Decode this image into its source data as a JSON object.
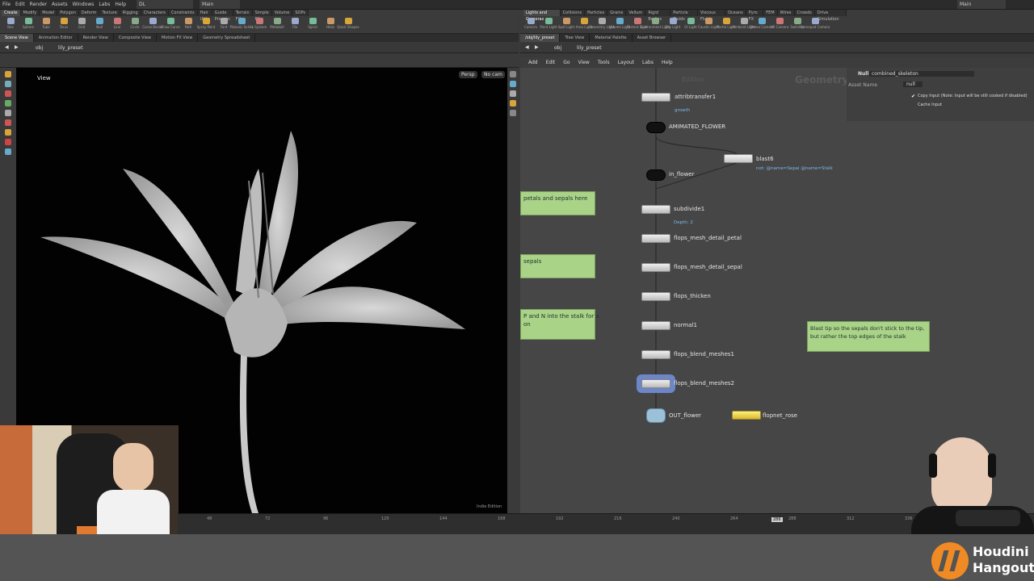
{
  "menubar": {
    "items": [
      "File",
      "Edit",
      "Render",
      "Assets",
      "Windows",
      "Labs",
      "Help"
    ],
    "desktop": "DL",
    "main_tab": "Main",
    "right_main": "Main"
  },
  "shelf_left": {
    "tabs": [
      "Create",
      "Modify",
      "Model",
      "Polygon",
      "Deform",
      "Texture",
      "Rigging",
      "Characters",
      "Constraints",
      "Hair Utils",
      "Guide Process",
      "Terrain FX",
      "Simple FX",
      "Volume",
      "SOPs"
    ],
    "tools": [
      "Box",
      "Sphere",
      "Tube",
      "Torus",
      "Grid",
      "Null",
      "Line",
      "Circle",
      "Curve Bezier",
      "Draw Curve",
      "Path",
      "Spray Paint",
      "Font",
      "Platonic Solids",
      "L-System",
      "Metaball",
      "File",
      "Spiral",
      "Helix",
      "Quick Shapes"
    ]
  },
  "shelf_right": {
    "tabs": [
      "Lights and Cameras",
      "Collisions",
      "Particles",
      "Grains",
      "Vellum",
      "Rigid Bodies",
      "Particle Fluids",
      "Viscous Fluids",
      "Oceans",
      "Pyro FX",
      "FEM",
      "Wires",
      "Crowds",
      "Drive Simulation"
    ],
    "tools": [
      "Camera",
      "Point Light",
      "Spot Light",
      "Area Light",
      "Geometry Light",
      "Volume Light",
      "Distant Light",
      "Environment Light",
      "Sky Light",
      "GI Light",
      "Caustic Light",
      "Portal Light",
      "Ambient Light",
      "Stereo Camera",
      "VR Camera",
      "Switcher",
      "Gamepad Camera"
    ]
  },
  "left_pane": {
    "tabs": [
      "Scene View",
      "Animation Editor",
      "Render View",
      "Composite View",
      "Motion FX View",
      "Geometry Spreadsheet"
    ],
    "path": [
      "obj",
      "lily_preset"
    ],
    "view_label": "View",
    "persp": "Persp",
    "cam": "No cam",
    "edition": "Indie Edition"
  },
  "right_pane": {
    "tabs": [
      "/obj/lily_preset",
      "Tree View",
      "Material Palette",
      "Asset Browser"
    ],
    "path": [
      "obj",
      "lily_preset"
    ],
    "menu": [
      "Add",
      "Edit",
      "Go",
      "View",
      "Tools",
      "Layout",
      "Labs",
      "Help"
    ],
    "watermark": "Geometry",
    "watermark2": "Edition"
  },
  "params": {
    "node_type": "Null",
    "node_name": "combined_skeleton",
    "asset_name_label": "Asset Name",
    "asset_name_value": "null",
    "copy_input": "Copy Input (Note: Input will be still cooked if disabled)",
    "cache_input": "Cache Input"
  },
  "nodes": [
    {
      "name": "attribtransfer1",
      "sub": "growth"
    },
    {
      "name": "AMIMATED_FLOWER",
      "sub": ""
    },
    {
      "name": "blast6",
      "sub": "not: @name=Sepal @name=Stalk"
    },
    {
      "name": "in_flower",
      "sub": ""
    },
    {
      "name": "subdivide1",
      "sub": "Depth: 2"
    },
    {
      "name": "flops_mesh_detail_petal",
      "sub": ""
    },
    {
      "name": "flops_mesh_detail_sepal",
      "sub": ""
    },
    {
      "name": "flops_thicken",
      "sub": ""
    },
    {
      "name": "normal1",
      "sub": ""
    },
    {
      "name": "flops_blend_meshes1",
      "sub": ""
    },
    {
      "name": "flops_blend_meshes2",
      "sub": ""
    },
    {
      "name": "OUT_flower",
      "sub": ""
    },
    {
      "name": "flopnet_rose",
      "sub": ""
    }
  ],
  "stickies": [
    "petals and sepals here",
    "sepals",
    "P and N into the stalk for a\non",
    "Blast tip so the sepals don't stick to the tip,\nbut rather the top edges of the stalk"
  ],
  "timeline": {
    "ticks": [
      "48",
      "72",
      "96",
      "120",
      "144",
      "168",
      "192",
      "216",
      "240",
      "264",
      "288",
      "312",
      "336"
    ],
    "current_frame": "286"
  },
  "brand": {
    "line1": "Houdini",
    "line2": "Hangout",
    "color": "#f08a24"
  }
}
